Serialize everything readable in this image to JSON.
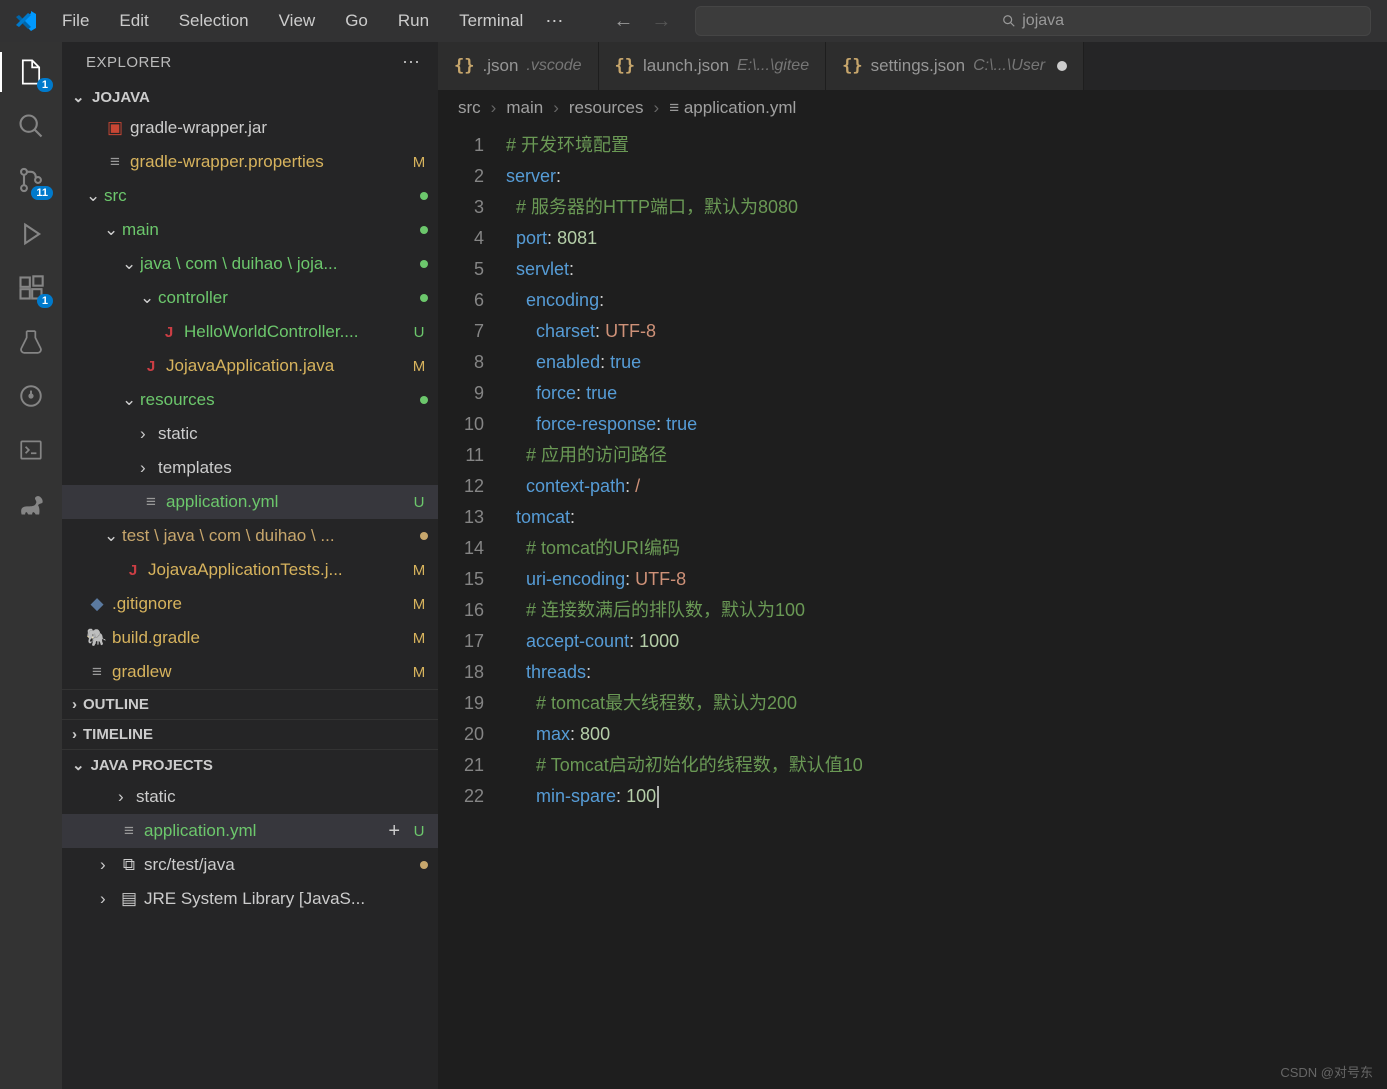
{
  "menu": [
    "File",
    "Edit",
    "Selection",
    "View",
    "Go",
    "Run",
    "Terminal"
  ],
  "search_text": "jojava",
  "activity": {
    "explorer_badge": "1",
    "scm_badge": "11",
    "ext_badge": "1"
  },
  "explorer": {
    "title": "EXPLORER",
    "project": "JOJAVA",
    "tree": [
      {
        "indent": 2,
        "icon": "jar",
        "label": "gradle-wrapper.jar",
        "status": "",
        "color": ""
      },
      {
        "indent": 2,
        "icon": "props",
        "label": "gradle-wrapper.properties",
        "status": "M",
        "color": "mod"
      },
      {
        "indent": 1,
        "icon": "chev-d",
        "label": "src",
        "status": "dot-green",
        "color": "folder-green"
      },
      {
        "indent": 2,
        "icon": "chev-d",
        "label": "main",
        "status": "dot-green",
        "color": "folder-green"
      },
      {
        "indent": 3,
        "icon": "chev-d",
        "label": "java \\ com \\ duihao \\ joja...",
        "status": "dot-green",
        "color": "folder-green"
      },
      {
        "indent": 4,
        "icon": "chev-d",
        "label": "controller",
        "status": "dot-green",
        "color": "folder-green"
      },
      {
        "indent": 5,
        "icon": "J",
        "label": "HelloWorldController....",
        "status": "U",
        "color": "unt"
      },
      {
        "indent": 4,
        "icon": "J",
        "label": "JojavaApplication.java",
        "status": "M",
        "color": "mod"
      },
      {
        "indent": 3,
        "icon": "chev-d",
        "label": "resources",
        "status": "dot-green",
        "color": "folder-green"
      },
      {
        "indent": 4,
        "icon": "chev-r",
        "label": "static",
        "status": "",
        "color": ""
      },
      {
        "indent": 4,
        "icon": "chev-r",
        "label": "templates",
        "status": "",
        "color": ""
      },
      {
        "indent": 4,
        "icon": "yml",
        "label": "application.yml",
        "status": "U",
        "color": "unt",
        "sel": true
      },
      {
        "indent": 2,
        "icon": "chev-d",
        "label": "test \\ java \\ com \\ duihao \\ ...",
        "status": "dot-orange",
        "color": "folder-orange"
      },
      {
        "indent": 3,
        "icon": "J",
        "label": "JojavaApplicationTests.j...",
        "status": "M",
        "color": "mod"
      },
      {
        "indent": 1,
        "icon": "git",
        "label": ".gitignore",
        "status": "M",
        "color": "mod"
      },
      {
        "indent": 1,
        "icon": "gradle",
        "label": "build.gradle",
        "status": "M",
        "color": "mod"
      },
      {
        "indent": 1,
        "icon": "props",
        "label": "gradlew",
        "status": "M",
        "color": "mod"
      }
    ],
    "outline": "OUTLINE",
    "timeline": "TIMELINE",
    "java_projects": "JAVA PROJECTS",
    "jp_tree": [
      {
        "indent": 2,
        "icon": "chev-r",
        "label": "static",
        "status": "",
        "sel": false
      },
      {
        "indent": 2,
        "icon": "yml",
        "label": "application.yml",
        "status": "U",
        "sel": true,
        "plus": true
      },
      {
        "indent": 1,
        "icon": "chev-r",
        "sub": "pkg",
        "label": "src/test/java",
        "status": "dot-orange"
      },
      {
        "indent": 1,
        "icon": "chev-r",
        "sub": "lib",
        "label": "JRE System Library [JavaS...",
        "status": ""
      }
    ]
  },
  "tabs": [
    {
      "icon": "{}",
      "name": ".json",
      "path": ".vscode",
      "dirty": false
    },
    {
      "icon": "{}",
      "name": "launch.json",
      "path": "E:\\...\\gitee",
      "dirty": false
    },
    {
      "icon": "{}",
      "name": "settings.json",
      "path": "C:\\...\\User",
      "dirty": true
    }
  ],
  "breadcrumb": [
    "src",
    "main",
    "resources",
    "application.yml"
  ],
  "code": {
    "lines": [
      [
        {
          "t": "# 开发环境配置",
          "c": "c-comment"
        }
      ],
      [
        {
          "t": "server",
          "c": "c-key"
        },
        {
          "t": ":",
          "c": ""
        }
      ],
      [
        {
          "t": "  # 服务器的HTTP端口，默认为8080",
          "c": "c-comment"
        }
      ],
      [
        {
          "t": "  ",
          "c": ""
        },
        {
          "t": "port",
          "c": "c-key"
        },
        {
          "t": ": ",
          "c": ""
        },
        {
          "t": "8081",
          "c": "c-num"
        }
      ],
      [
        {
          "t": "  ",
          "c": ""
        },
        {
          "t": "servlet",
          "c": "c-key"
        },
        {
          "t": ":",
          "c": ""
        }
      ],
      [
        {
          "t": "    ",
          "c": ""
        },
        {
          "t": "encoding",
          "c": "c-key"
        },
        {
          "t": ":",
          "c": ""
        }
      ],
      [
        {
          "t": "      ",
          "c": ""
        },
        {
          "t": "charset",
          "c": "c-key"
        },
        {
          "t": ": ",
          "c": ""
        },
        {
          "t": "UTF-8",
          "c": "c-val"
        }
      ],
      [
        {
          "t": "      ",
          "c": ""
        },
        {
          "t": "enabled",
          "c": "c-key"
        },
        {
          "t": ": ",
          "c": ""
        },
        {
          "t": "true",
          "c": "c-bool"
        }
      ],
      [
        {
          "t": "      ",
          "c": ""
        },
        {
          "t": "force",
          "c": "c-key"
        },
        {
          "t": ": ",
          "c": ""
        },
        {
          "t": "true",
          "c": "c-bool"
        }
      ],
      [
        {
          "t": "      ",
          "c": ""
        },
        {
          "t": "force-response",
          "c": "c-key"
        },
        {
          "t": ": ",
          "c": ""
        },
        {
          "t": "true",
          "c": "c-bool"
        }
      ],
      [
        {
          "t": "    # 应用的访问路径",
          "c": "c-comment"
        }
      ],
      [
        {
          "t": "    ",
          "c": ""
        },
        {
          "t": "context-path",
          "c": "c-key"
        },
        {
          "t": ": ",
          "c": ""
        },
        {
          "t": "/",
          "c": "c-val"
        }
      ],
      [
        {
          "t": "  ",
          "c": ""
        },
        {
          "t": "tomcat",
          "c": "c-key"
        },
        {
          "t": ":",
          "c": ""
        }
      ],
      [
        {
          "t": "    # tomcat的URI编码",
          "c": "c-comment"
        }
      ],
      [
        {
          "t": "    ",
          "c": ""
        },
        {
          "t": "uri-encoding",
          "c": "c-key"
        },
        {
          "t": ": ",
          "c": ""
        },
        {
          "t": "UTF-8",
          "c": "c-val"
        }
      ],
      [
        {
          "t": "    # 连接数满后的排队数，默认为100",
          "c": "c-comment"
        }
      ],
      [
        {
          "t": "    ",
          "c": ""
        },
        {
          "t": "accept-count",
          "c": "c-key"
        },
        {
          "t": ": ",
          "c": ""
        },
        {
          "t": "1000",
          "c": "c-num"
        }
      ],
      [
        {
          "t": "    ",
          "c": ""
        },
        {
          "t": "threads",
          "c": "c-key"
        },
        {
          "t": ":",
          "c": ""
        }
      ],
      [
        {
          "t": "      # tomcat最大线程数，默认为200",
          "c": "c-comment"
        }
      ],
      [
        {
          "t": "      ",
          "c": ""
        },
        {
          "t": "max",
          "c": "c-key"
        },
        {
          "t": ": ",
          "c": ""
        },
        {
          "t": "800",
          "c": "c-num"
        }
      ],
      [
        {
          "t": "      # Tomcat启动初始化的线程数，默认值10",
          "c": "c-comment"
        }
      ],
      [
        {
          "t": "      ",
          "c": ""
        },
        {
          "t": "min-spare",
          "c": "c-key"
        },
        {
          "t": ": ",
          "c": ""
        },
        {
          "t": "100",
          "c": "c-num"
        },
        {
          "t": "",
          "c": "",
          "cursor": true
        }
      ]
    ]
  },
  "watermark": "CSDN @对号东"
}
